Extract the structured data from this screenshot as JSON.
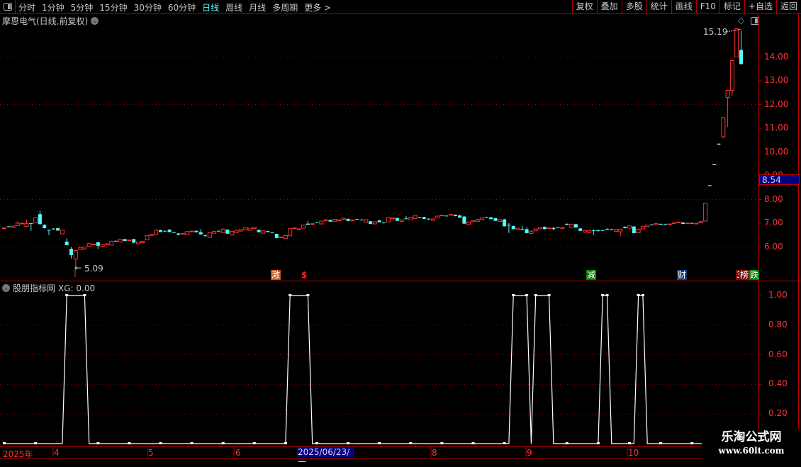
{
  "toolbar": {
    "periods": [
      "分时",
      "1分钟",
      "5分钟",
      "15分钟",
      "30分钟",
      "60分钟",
      "日线",
      "周线",
      "月线",
      "多周期",
      "更多 >"
    ],
    "active_period": "日线",
    "actions": [
      "复权",
      "叠加",
      "多股",
      "统计",
      "画线",
      "F10",
      "标记",
      "+自选",
      "返回"
    ]
  },
  "chart": {
    "title": "摩恩电气(日线,前复权)",
    "high_label": "15.19",
    "low_label": "5.09",
    "current_price": "8.54",
    "price_ticks": [
      "14.00",
      "13.00",
      "12.00",
      "11.00",
      "10.00",
      "9.00",
      "8.00",
      "7.00",
      "6.00"
    ],
    "colors": {
      "up": "#ff3232",
      "down": "#54fcfc",
      "flat": "#ffffff",
      "grid": "#a00000",
      "axis": "#c00000"
    },
    "markers": [
      {
        "text": "激",
        "bg": "#c0501a"
      },
      {
        "text": "$",
        "bg": "transparent",
        "color": "#ff2020"
      },
      {
        "text": "减",
        "bg": "#008000"
      },
      {
        "text": "财",
        "bg": "#103c78"
      },
      {
        "text": "3",
        "bg": "#7a1010"
      },
      {
        "text": "榜",
        "bg": "#7a1010"
      },
      {
        "text": "跌",
        "bg": "#008000"
      }
    ],
    "candles": [
      [
        6.78,
        6.82,
        6.75,
        6.8
      ],
      [
        6.87,
        6.88,
        6.84,
        6.86
      ],
      [
        6.83,
        6.89,
        6.8,
        6.88
      ],
      [
        6.9,
        7.1,
        6.88,
        7.0
      ],
      [
        6.98,
        7.02,
        6.96,
        7.0
      ],
      [
        6.87,
        7.15,
        6.85,
        6.99
      ],
      [
        7.0,
        7.01,
        6.68,
        6.99
      ],
      [
        7.01,
        7.24,
        7.0,
        7.23
      ],
      [
        7.38,
        7.52,
        6.95,
        6.96
      ],
      [
        6.93,
        6.96,
        6.78,
        6.79
      ],
      [
        6.72,
        6.73,
        6.5,
        6.71
      ],
      [
        6.77,
        6.79,
        6.74,
        6.76
      ],
      [
        6.79,
        6.8,
        6.69,
        6.69
      ],
      [
        6.55,
        6.72,
        6.54,
        6.71
      ],
      [
        6.22,
        6.36,
        6.07,
        6.08
      ],
      [
        5.92,
        5.99,
        5.52,
        5.66
      ],
      [
        5.49,
        5.85,
        5.09,
        5.85
      ],
      [
        5.9,
        5.99,
        5.88,
        5.98
      ],
      [
        5.92,
        6.01,
        5.88,
        6.0
      ],
      [
        6.02,
        6.18,
        6.0,
        6.14
      ],
      [
        6.11,
        6.13,
        6.1,
        6.12
      ],
      [
        6.2,
        6.21,
        5.92,
        6.05
      ],
      [
        6.02,
        6.11,
        6.0,
        6.1
      ],
      [
        6.12,
        6.14,
        6.1,
        6.13
      ],
      [
        6.08,
        6.26,
        6.07,
        6.24
      ],
      [
        6.26,
        6.27,
        6.22,
        6.25
      ],
      [
        6.21,
        6.34,
        6.2,
        6.33
      ],
      [
        6.33,
        6.34,
        6.25,
        6.25
      ],
      [
        6.26,
        6.3,
        6.25,
        6.29
      ],
      [
        6.33,
        6.34,
        6.17,
        6.18
      ],
      [
        6.13,
        6.22,
        6.12,
        6.21
      ],
      [
        6.18,
        6.26,
        6.17,
        6.24
      ],
      [
        6.3,
        6.49,
        6.29,
        6.48
      ],
      [
        6.49,
        6.54,
        6.48,
        6.53
      ],
      [
        6.53,
        6.72,
        6.52,
        6.71
      ],
      [
        6.71,
        6.72,
        6.63,
        6.63
      ],
      [
        6.68,
        6.69,
        6.64,
        6.67
      ],
      [
        6.73,
        6.75,
        6.63,
        6.63
      ],
      [
        6.61,
        6.62,
        6.58,
        6.6
      ],
      [
        6.57,
        6.58,
        6.5,
        6.51
      ],
      [
        6.54,
        6.58,
        6.53,
        6.57
      ],
      [
        6.53,
        6.66,
        6.52,
        6.65
      ],
      [
        6.65,
        6.68,
        6.64,
        6.67
      ],
      [
        6.68,
        6.69,
        6.61,
        6.62
      ],
      [
        6.62,
        6.75,
        6.52,
        6.53
      ],
      [
        6.49,
        6.5,
        6.43,
        6.48
      ],
      [
        6.4,
        6.61,
        6.39,
        6.6
      ],
      [
        6.58,
        6.67,
        6.57,
        6.66
      ],
      [
        6.68,
        6.69,
        6.66,
        6.67
      ],
      [
        6.6,
        6.8,
        6.59,
        6.75
      ],
      [
        6.73,
        6.75,
        6.55,
        6.56
      ],
      [
        6.5,
        6.67,
        6.49,
        6.66
      ],
      [
        6.61,
        6.71,
        6.6,
        6.7
      ],
      [
        6.67,
        6.73,
        6.66,
        6.73
      ],
      [
        6.73,
        6.84,
        6.72,
        6.83
      ],
      [
        6.7,
        6.8,
        6.69,
        6.79
      ],
      [
        6.77,
        6.84,
        6.76,
        6.83
      ],
      [
        6.72,
        6.73,
        6.62,
        6.62
      ],
      [
        6.58,
        6.69,
        6.57,
        6.68
      ],
      [
        6.67,
        6.68,
        6.63,
        6.63
      ],
      [
        6.61,
        6.62,
        6.59,
        6.6
      ],
      [
        6.55,
        6.56,
        6.36,
        6.38
      ],
      [
        6.4,
        6.43,
        6.39,
        6.42
      ],
      [
        6.35,
        6.49,
        6.34,
        6.48
      ],
      [
        6.47,
        6.78,
        6.46,
        6.77
      ],
      [
        6.79,
        6.82,
        6.78,
        6.8
      ],
      [
        6.75,
        6.77,
        6.74,
        6.76
      ],
      [
        6.79,
        6.94,
        6.78,
        6.93
      ],
      [
        6.98,
        7.1,
        6.93,
        6.94
      ],
      [
        6.95,
        6.99,
        6.94,
        6.98
      ],
      [
        7.04,
        7.05,
        7.01,
        7.03
      ],
      [
        6.97,
        7.1,
        6.96,
        7.09
      ],
      [
        7.11,
        7.15,
        7.1,
        7.14
      ],
      [
        7.14,
        7.15,
        7.05,
        7.07
      ],
      [
        7.08,
        7.17,
        7.07,
        7.16
      ],
      [
        7.13,
        7.16,
        7.12,
        7.14
      ],
      [
        7.16,
        7.22,
        7.15,
        7.21
      ],
      [
        7.18,
        7.2,
        7.08,
        7.1
      ],
      [
        7.13,
        7.15,
        7.12,
        7.14
      ],
      [
        7.17,
        7.19,
        7.14,
        7.16
      ],
      [
        7.15,
        7.17,
        7.12,
        7.14
      ],
      [
        7.05,
        7.16,
        7.04,
        7.15
      ],
      [
        7.08,
        7.09,
        6.96,
        6.97
      ],
      [
        6.97,
        7.07,
        6.96,
        7.06
      ],
      [
        7.12,
        7.13,
        7.04,
        7.04
      ],
      [
        7.03,
        7.04,
        6.99,
        7.02
      ],
      [
        7.05,
        7.25,
        7.04,
        7.24
      ],
      [
        7.2,
        7.23,
        7.18,
        7.22
      ],
      [
        7.22,
        7.23,
        7.1,
        7.1
      ],
      [
        7.08,
        7.15,
        7.07,
        7.14
      ],
      [
        7.2,
        7.3,
        7.16,
        7.19
      ],
      [
        7.14,
        7.26,
        7.13,
        7.25
      ],
      [
        7.2,
        7.34,
        7.19,
        7.33
      ],
      [
        7.25,
        7.27,
        7.21,
        7.24
      ],
      [
        7.26,
        7.27,
        7.16,
        7.18
      ],
      [
        7.19,
        7.2,
        7.15,
        7.18
      ],
      [
        7.12,
        7.19,
        7.11,
        7.18
      ],
      [
        7.22,
        7.3,
        7.21,
        7.3
      ],
      [
        7.33,
        7.36,
        7.32,
        7.34
      ],
      [
        7.32,
        7.33,
        7.28,
        7.31
      ],
      [
        7.36,
        7.38,
        7.35,
        7.37
      ],
      [
        7.36,
        7.37,
        7.29,
        7.3
      ],
      [
        7.33,
        7.34,
        7.22,
        7.24
      ],
      [
        7.28,
        7.3,
        6.96,
        6.98
      ],
      [
        6.94,
        7.06,
        6.93,
        7.05
      ],
      [
        7.07,
        7.12,
        7.06,
        7.11
      ],
      [
        7.08,
        7.17,
        7.07,
        7.16
      ],
      [
        7.16,
        7.24,
        7.15,
        7.23
      ],
      [
        7.26,
        7.27,
        7.24,
        7.25
      ],
      [
        7.25,
        7.26,
        7.17,
        7.17
      ],
      [
        7.21,
        7.23,
        7.09,
        7.1
      ],
      [
        7.07,
        7.16,
        7.06,
        7.15
      ],
      [
        7.16,
        7.18,
        6.86,
        6.87
      ],
      [
        6.93,
        7.0,
        6.59,
        6.92
      ],
      [
        6.88,
        6.9,
        6.74,
        6.75
      ],
      [
        6.73,
        6.8,
        6.72,
        6.79
      ],
      [
        6.75,
        6.88,
        6.7,
        6.74
      ],
      [
        6.75,
        6.82,
        6.57,
        6.58
      ],
      [
        6.57,
        6.7,
        6.56,
        6.65
      ],
      [
        6.68,
        6.77,
        6.67,
        6.76
      ],
      [
        6.76,
        6.83,
        6.75,
        6.82
      ],
      [
        6.85,
        6.86,
        6.74,
        6.75
      ],
      [
        6.79,
        6.81,
        6.78,
        6.8
      ],
      [
        6.8,
        6.82,
        6.7,
        6.8
      ],
      [
        6.83,
        6.84,
        6.81,
        6.82
      ],
      [
        6.78,
        6.83,
        6.77,
        6.82
      ],
      [
        6.96,
        6.99,
        6.95,
        6.96
      ],
      [
        6.82,
        6.97,
        6.81,
        6.96
      ],
      [
        6.96,
        6.97,
        6.81,
        6.82
      ],
      [
        6.78,
        6.8,
        6.67,
        6.68
      ],
      [
        6.63,
        6.7,
        6.61,
        6.69
      ],
      [
        6.62,
        6.72,
        6.58,
        6.7
      ],
      [
        6.7,
        6.72,
        6.5,
        6.69
      ],
      [
        6.7,
        6.73,
        6.65,
        6.69
      ],
      [
        6.71,
        6.72,
        6.67,
        6.7
      ],
      [
        6.76,
        6.79,
        6.73,
        6.74
      ],
      [
        6.75,
        6.76,
        6.72,
        6.74
      ],
      [
        6.66,
        6.75,
        6.65,
        6.74
      ],
      [
        6.64,
        6.76,
        6.45,
        6.75
      ],
      [
        6.84,
        6.88,
        6.78,
        6.79
      ],
      [
        6.79,
        6.9,
        6.78,
        6.89
      ],
      [
        6.86,
        6.88,
        6.58,
        6.58
      ],
      [
        6.6,
        6.76,
        6.59,
        6.75
      ],
      [
        6.76,
        6.88,
        6.75,
        6.87
      ],
      [
        6.85,
        6.93,
        6.84,
        6.92
      ],
      [
        6.95,
        6.96,
        6.93,
        6.94
      ],
      [
        6.94,
        7.0,
        6.93,
        6.99
      ],
      [
        6.97,
        6.99,
        6.95,
        6.96
      ],
      [
        6.96,
        6.98,
        6.94,
        6.95
      ],
      [
        6.96,
        6.98,
        6.95,
        6.97
      ],
      [
        6.98,
        7.03,
        6.97,
        7.02
      ],
      [
        7.04,
        7.06,
        7.03,
        7.05
      ],
      [
        7.03,
        7.05,
        6.96,
        6.97
      ],
      [
        6.98,
        7.02,
        6.97,
        7.01
      ],
      [
        7.01,
        7.03,
        6.99,
        7.0
      ],
      [
        6.99,
        7.01,
        6.98,
        7.0
      ],
      [
        7.02,
        7.08,
        7.01,
        7.07
      ],
      [
        7.09,
        7.84,
        7.09,
        7.84
      ],
      [
        8.6,
        8.6,
        8.6,
        8.6
      ],
      [
        9.48,
        9.48,
        9.48,
        9.48
      ],
      [
        10.35,
        10.35,
        10.3,
        10.35
      ],
      [
        10.64,
        11.45,
        10.58,
        11.45
      ],
      [
        12.3,
        12.62,
        11.05,
        12.6
      ],
      [
        12.6,
        13.85,
        12.35,
        13.85
      ],
      [
        14.0,
        15.19,
        14.0,
        15.19
      ],
      [
        14.3,
        15.1,
        13.7,
        13.7
      ]
    ]
  },
  "indicator": {
    "title": "股朋指标网",
    "value_label": "XG: 0.00",
    "ticks": [
      "1.00",
      "0.80",
      "0.60",
      "0.40",
      "0.20"
    ],
    "xg_on_ranges": [
      [
        14,
        18
      ],
      [
        64,
        68
      ],
      [
        114,
        117
      ],
      [
        119,
        122
      ],
      [
        134,
        135
      ],
      [
        142,
        143
      ]
    ]
  },
  "date_axis": {
    "labels": [
      "2025年",
      "4",
      "5",
      "6",
      "8",
      "9",
      "10"
    ],
    "selected_date": "2025/06/23/一"
  },
  "watermark": {
    "name": "乐淘公式网",
    "url": "www.60lt.com"
  }
}
